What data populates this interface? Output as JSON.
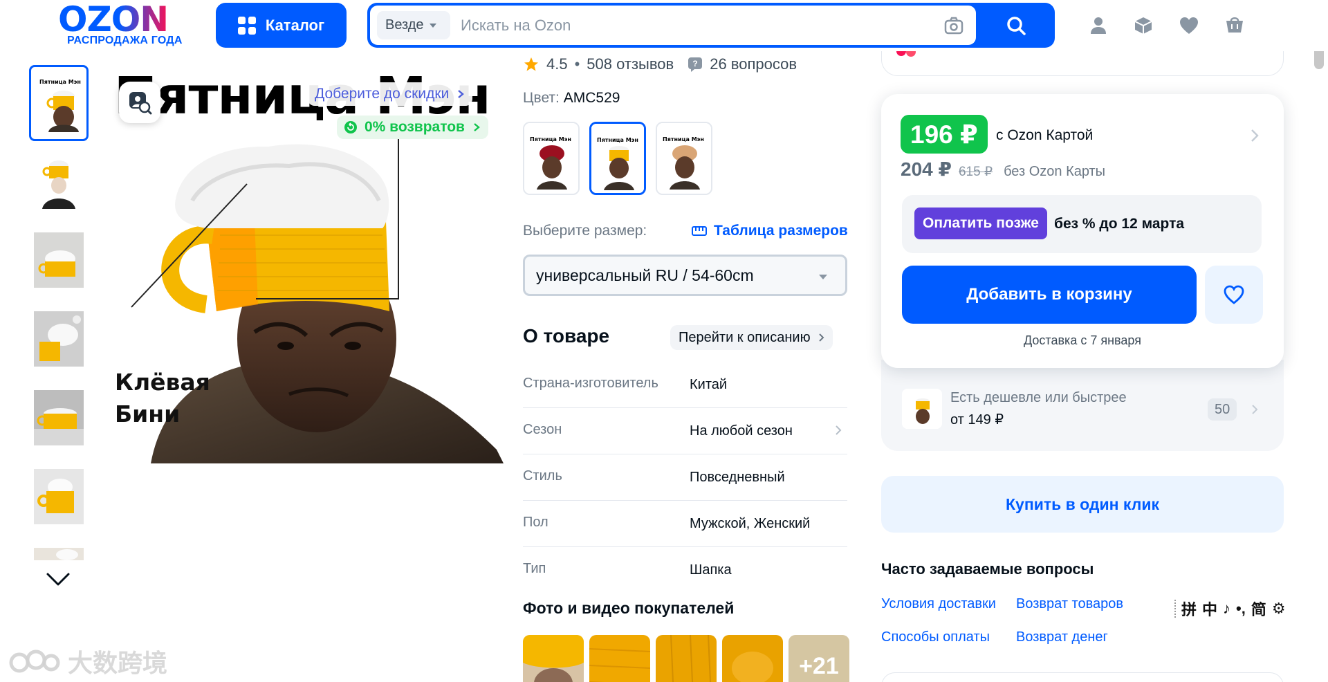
{
  "header": {
    "logo_word": "OZON",
    "logo_sub": "РАСПРОДАЖА ГОДА",
    "catalog_label": "Каталог",
    "search_scope": "Везде",
    "search_placeholder": "Искать на Ozon"
  },
  "gallery": {
    "image_title_text": "Пятница Мэн",
    "image_caption_line1": "Клёвая",
    "image_caption_line2": "Бини",
    "discount_chip": "Доберите до скидки",
    "returns_chip": "0% возвратов",
    "thumbnail_label": "Пятница Мэн"
  },
  "product": {
    "rating": "4.5",
    "reviews": "508 отзывов",
    "questions": "26 вопросов",
    "color_label": "Цвет:",
    "color_value": "AMC529",
    "variant_label": "Пятница Мэн",
    "size_label": "Выберите размер:",
    "size_table": "Таблица размеров",
    "size_selected": "универсальный RU / 54-60cm",
    "about_title": "О товаре",
    "about_link": "Перейти к описанию",
    "specs": [
      {
        "key": "Страна-изготовитель",
        "value": "Китай"
      },
      {
        "key": "Сезон",
        "value": "На любой сезон"
      },
      {
        "key": "Стиль",
        "value": "Повседневный"
      },
      {
        "key": "Пол",
        "value": "Мужской, Женский"
      },
      {
        "key": "Тип",
        "value": "Шапка"
      }
    ],
    "photos_title": "Фото и видео покупателей",
    "photos_more": "+21"
  },
  "buy": {
    "price_card": "196 ₽",
    "with_card": "с Ozon Картой",
    "price_no_card": "204 ₽",
    "price_old": "615 ₽",
    "no_card_label": "без Ozon Карты",
    "pay_later": "Оплатить позже",
    "pay_later_terms": "без % до 12 марта",
    "add_to_cart": "Добавить в корзину",
    "delivery": "Доставка с 7 января",
    "cheaper_text": "Есть дешевле или быстрее",
    "cheaper_price": "от 149 ₽",
    "cheaper_count": "50",
    "one_click": "Купить в один клик"
  },
  "faq": {
    "title": "Часто задаваемые вопросы",
    "links": [
      "Условия доставки",
      "Возврат товаров",
      "Способы оплаты",
      "Возврат денег"
    ]
  },
  "ime": {
    "glyphs": [
      "拼",
      "中",
      "♪",
      "•,",
      "简",
      "⚙"
    ]
  },
  "watermark": "大数跨境",
  "colors": {
    "brand_blue": "#005bff",
    "green_price": "#10c44c",
    "pay_later_purple": "#6140dc",
    "brand_pink": "#f91155"
  }
}
